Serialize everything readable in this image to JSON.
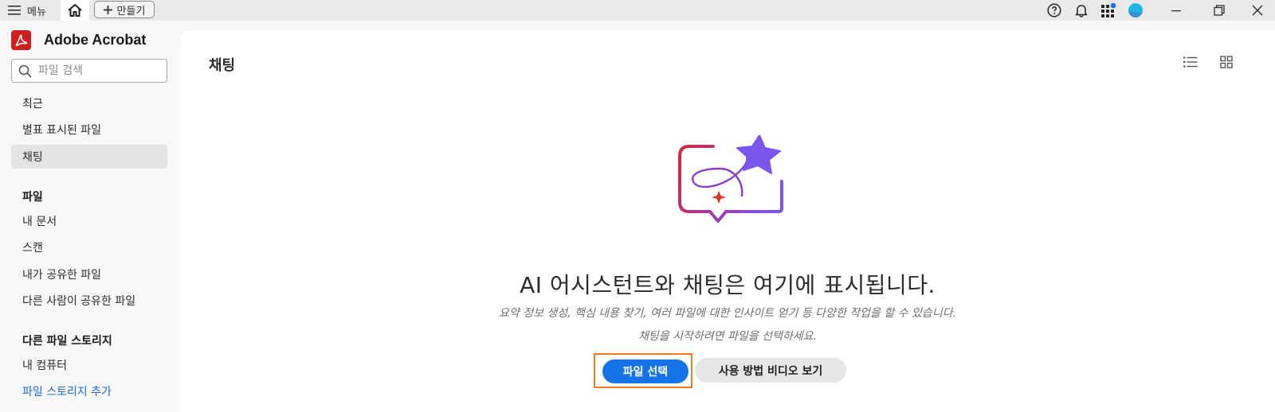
{
  "topbar": {
    "menu_label": "메뉴",
    "create_label": "만들기"
  },
  "brand": {
    "name": "Adobe Acrobat"
  },
  "search": {
    "placeholder": "파일 검색"
  },
  "sidebar": {
    "items": [
      {
        "label": "최근"
      },
      {
        "label": "별표 표시된 파일"
      },
      {
        "label": "채팅",
        "active": true
      }
    ],
    "files_heading": "파일",
    "file_items": [
      {
        "label": "내 문서"
      },
      {
        "label": "스캔"
      },
      {
        "label": "내가 공유한 파일"
      },
      {
        "label": "다른 사람이 공유한 파일"
      }
    ],
    "storage_heading": "다른 파일 스토리지",
    "storage_items": [
      {
        "label": "내 컴퓨터"
      },
      {
        "label": "파일 스토리지 추가"
      }
    ]
  },
  "main": {
    "title": "채팅",
    "empty_title": "AI 어시스턴트와 채팅은 여기에 표시됩니다.",
    "empty_sub1": "요약 정보 생성, 핵심 내용 찾기, 여러 파일에 대한 인사이트 얻기 등 다양한 작업을 할 수 있습니다.",
    "empty_sub2": "채팅을 시작하려면 파일을 선택하세요.",
    "primary_button": "파일 선택",
    "secondary_button": "사용 방법 비디오 보기"
  },
  "colors": {
    "accent": "#1473e6",
    "brand_red": "#cf1e1e",
    "link": "#1c6dd0",
    "highlight_outline": "#ef7a21",
    "avatar": "#1fb5e0"
  },
  "icons": [
    "hamburger-icon",
    "home-icon",
    "plus-icon",
    "help-icon",
    "bell-icon",
    "apps-icon",
    "avatar",
    "minimize-icon",
    "restore-icon",
    "close-icon",
    "search-icon",
    "list-view-icon",
    "grid-view-icon"
  ]
}
